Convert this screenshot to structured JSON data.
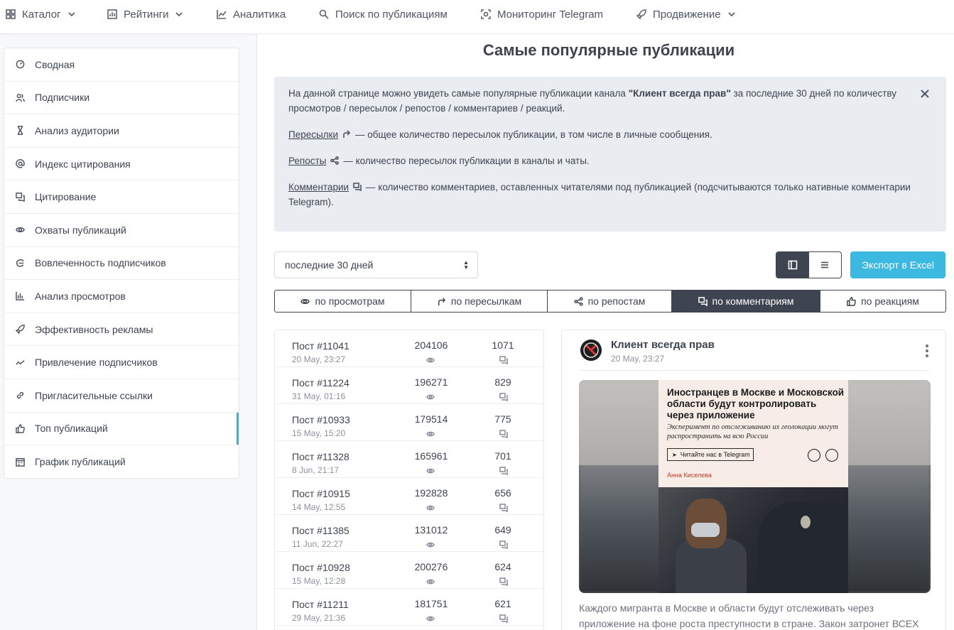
{
  "nav": {
    "items": [
      {
        "label": "Каталог",
        "icon": "grid-icon"
      },
      {
        "label": "Рейтинги",
        "icon": "bar-chart-icon"
      },
      {
        "label": "Аналитика",
        "icon": "line-chart-icon"
      },
      {
        "label": "Поиск по публикациям",
        "icon": "search-icon"
      },
      {
        "label": "Мониторинг Telegram",
        "icon": "scan-icon"
      },
      {
        "label": "Продвижение",
        "icon": "rocket-icon"
      }
    ]
  },
  "sidebar": {
    "items": [
      {
        "label": "Сводная",
        "icon": "dashboard-icon"
      },
      {
        "label": "Подписчики",
        "icon": "users-icon"
      },
      {
        "label": "Анализ аудитории",
        "icon": "hourglass-icon"
      },
      {
        "label": "Индекс цитирования",
        "icon": "at-icon"
      },
      {
        "label": "Цитирование",
        "icon": "quote-icon"
      },
      {
        "label": "Охваты публикаций",
        "icon": "eye-icon"
      },
      {
        "label": "Вовлеченность подписчиков",
        "icon": "engagement-icon"
      },
      {
        "label": "Анализ просмотров",
        "icon": "bars-icon"
      },
      {
        "label": "Эффективность рекламы",
        "icon": "rocket-icon"
      },
      {
        "label": "Привлечение подписчиков",
        "icon": "trend-icon"
      },
      {
        "label": "Пригласительные ссылки",
        "icon": "link-icon"
      },
      {
        "label": "Топ публикаций",
        "icon": "thumbs-up-icon",
        "active": true
      },
      {
        "label": "График публикаций",
        "icon": "calendar-icon"
      }
    ]
  },
  "page": {
    "title": "Самые популярные публикации"
  },
  "info": {
    "p1_before": "На данной странице можно увидеть самые популярные публикации канала ",
    "channel_quoted": "\"Клиент всегда прав\"",
    "p1_after": " за последние 30 дней по количеству просмотров / пересылок / репостов / комментариев / реакций.",
    "forwards_term": "Пересылки",
    "forwards_desc": "— общее количество пересылок публикации, в том числе в личные сообщения.",
    "reposts_term": "Репосты",
    "reposts_desc": "— количество пересылок публикации в каналы и чаты.",
    "comments_term": "Комментарии",
    "comments_desc": "— количество комментариев, оставленных читателями под публикацией (подсчитываются только нативные комментарии Telegram)."
  },
  "controls": {
    "period": "последние 30 дней",
    "export_label": "Экспорт в Excel"
  },
  "tabs": [
    {
      "label": "по просмотрам",
      "icon": "eye-icon"
    },
    {
      "label": "по пересылкам",
      "icon": "forward-icon"
    },
    {
      "label": "по репостам",
      "icon": "share-icon"
    },
    {
      "label": "по комментариям",
      "icon": "comment-icon",
      "active": true
    },
    {
      "label": "по реакциям",
      "icon": "thumbs-up-icon"
    }
  ],
  "posts": [
    {
      "title": "Пост #11041",
      "date": "20 May, 23:27",
      "views": "204106",
      "comments": "1071"
    },
    {
      "title": "Пост #11224",
      "date": "31 May, 01:16",
      "views": "196271",
      "comments": "829"
    },
    {
      "title": "Пост #10933",
      "date": "15 May, 15:20",
      "views": "179514",
      "comments": "775"
    },
    {
      "title": "Пост #11328",
      "date": "8 Jun, 21:17",
      "views": "165961",
      "comments": "701"
    },
    {
      "title": "Пост #10915",
      "date": "14 May, 12:55",
      "views": "192828",
      "comments": "656"
    },
    {
      "title": "Пост #11385",
      "date": "11 Jun, 22:27",
      "views": "131012",
      "comments": "649"
    },
    {
      "title": "Пост #10928",
      "date": "15 May, 12:28",
      "views": "200276",
      "comments": "624"
    },
    {
      "title": "Пост #11211",
      "date": "29 May, 21:36",
      "views": "181751",
      "comments": "621"
    }
  ],
  "card": {
    "channel": "Клиент всегда прав",
    "date": "20 May, 23:27",
    "image_headline": "Иностранцев в Москве и Московской области будут контролировать через приложение",
    "image_subtitle": "Эксперимент по отслеживанию их геолокации могут распространить на всю России",
    "image_button": "Читайте нас в Telegram",
    "image_author": "Анна Киселева",
    "text": "Каждого мигранта в Москве и области будут отслеживать через приложение на фоне роста преступности в стране. Закон затронет ВСЕХ"
  },
  "colors": {
    "accent": "#3bb9e0",
    "dark": "#3e4450",
    "info_bg": "#e9edf2",
    "active_marker": "#3bb3d6"
  }
}
